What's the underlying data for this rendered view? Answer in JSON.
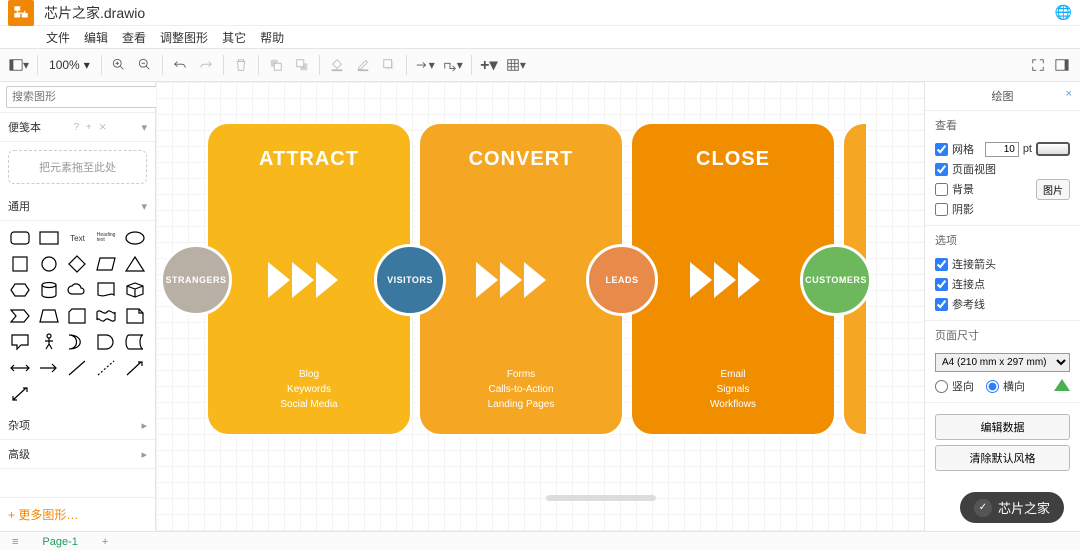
{
  "title": "芯片之家.drawio",
  "menus": {
    "file": "文件",
    "edit": "编辑",
    "view": "查看",
    "adjust": "调整图形",
    "other": "其它",
    "help": "帮助"
  },
  "zoom": "100%",
  "left": {
    "search_ph": "搜索图形",
    "scratchpad": "便笺本",
    "scratch_hint": "把元素拖至此处",
    "general": "通用",
    "misc": "杂项",
    "advanced": "高级",
    "more": "+ 更多图形…",
    "hints": "? + ⨯"
  },
  "right": {
    "title": "绘图",
    "view": "查看",
    "grid": "网格",
    "gridpt": "10",
    "pt": "pt",
    "pageview": "页面视图",
    "background": "背景",
    "bgbtn": "图片",
    "shadow": "阴影",
    "options": "选项",
    "connarrow": "连接箭头",
    "connpoint": "连接点",
    "guides": "参考线",
    "pagesize": "页面尺寸",
    "a4": "A4 (210 mm x 297 mm)",
    "portrait": "竖向",
    "landscape": "横向",
    "editdata": "编辑数据",
    "cleardef": "清除默认风格"
  },
  "diagram": {
    "cards": [
      {
        "title": "ATTRACT",
        "subs": [
          "Blog",
          "Keywords",
          "Social Media"
        ]
      },
      {
        "title": "CONVERT",
        "subs": [
          "Forms",
          "Calls-to-Action",
          "Landing Pages"
        ]
      },
      {
        "title": "CLOSE",
        "subs": [
          "Email",
          "Signals",
          "Workflows"
        ]
      }
    ],
    "circles": [
      "STRANGERS",
      "VISITORS",
      "LEADS",
      "CUSTOMERS"
    ]
  },
  "chart_data": {
    "type": "diagram",
    "flow": [
      {
        "stage": "ATTRACT",
        "from": "STRANGERS",
        "to": "VISITORS",
        "channels": [
          "Blog",
          "Keywords",
          "Social Media"
        ]
      },
      {
        "stage": "CONVERT",
        "from": "VISITORS",
        "to": "LEADS",
        "channels": [
          "Forms",
          "Calls-to-Action",
          "Landing Pages"
        ]
      },
      {
        "stage": "CLOSE",
        "from": "LEADS",
        "to": "CUSTOMERS",
        "channels": [
          "Email",
          "Signals",
          "Workflows"
        ]
      }
    ]
  },
  "tabs": {
    "page": "Page-1"
  },
  "watermark": "芯片之家"
}
